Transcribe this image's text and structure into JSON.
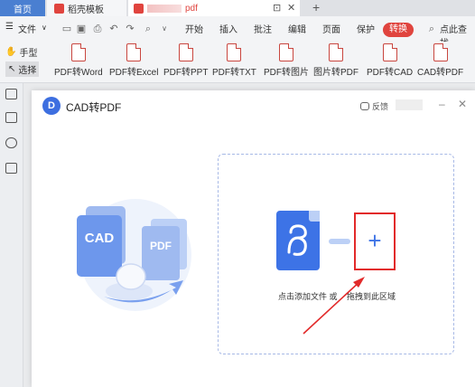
{
  "tabs": {
    "home": "首页",
    "template": "稻壳模板",
    "pdf_suffix": "pdf"
  },
  "menu": {
    "file": "文件",
    "items": [
      "开始",
      "插入",
      "批注",
      "编辑",
      "页面",
      "保护"
    ],
    "convert": "转换",
    "search": "点此查找"
  },
  "mode": {
    "hand": "手型",
    "select": "选择"
  },
  "toolbar": {
    "items": [
      "PDF转Word",
      "PDF转Excel",
      "PDF转PPT",
      "PDF转TXT",
      "PDF转图片",
      "图片转PDF",
      "PDF转CAD",
      "CAD转PDF"
    ]
  },
  "dialog": {
    "title": "CAD转PDF",
    "feedback": "反馈",
    "illustration": {
      "cad": "CAD",
      "pdf": "PDF"
    },
    "hint_prefix": "点击添加文件 或",
    "hint_suffix": "拖拽到此区域"
  },
  "colors": {
    "accent": "#3d73e6",
    "highlight": "#e22a2a",
    "convert": "#e0443e"
  }
}
